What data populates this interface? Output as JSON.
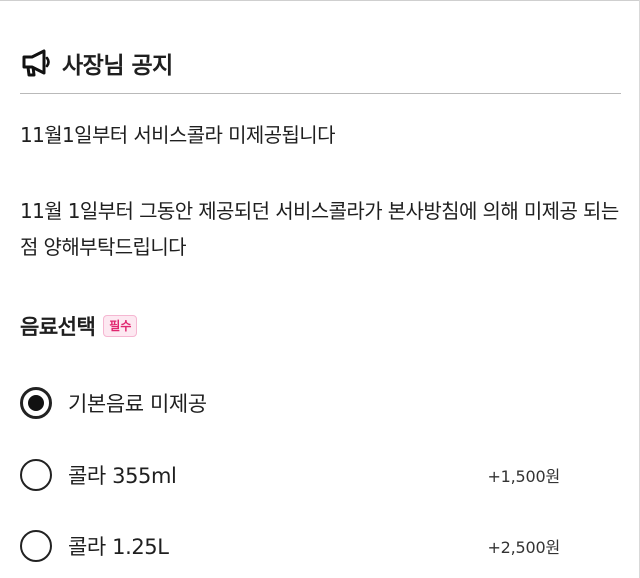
{
  "notice": {
    "icon": "megaphone-icon",
    "title": "사장님 공지",
    "headline": "11월1일부터 서비스콜라 미제공됩니다",
    "body": "11월 1일부터 그동안 제공되던 서비스콜라가  본사방침에 의해 미제공 되는점 양해부탁드립니다"
  },
  "drink_selection": {
    "title": "음료선택",
    "required_badge": "필수",
    "options": [
      {
        "label": "기본음료 미제공",
        "price": "",
        "selected": true
      },
      {
        "label": "콜라 355ml",
        "price": "+1,500원",
        "selected": false
      },
      {
        "label": "콜라 1.25L",
        "price": "+2,500원",
        "selected": false
      }
    ]
  },
  "colors": {
    "badge_text": "#e0266f",
    "badge_bg": "#fde8f1",
    "text": "#1f1f1f"
  }
}
